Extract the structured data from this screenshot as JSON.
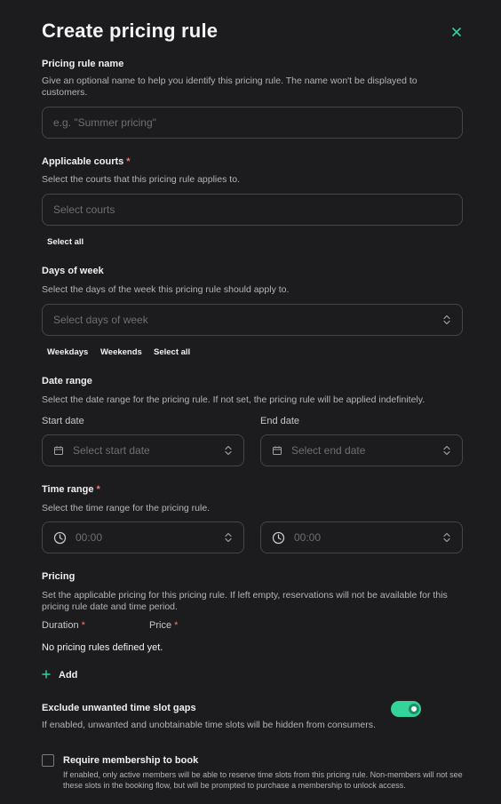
{
  "dialog": {
    "title": "Create pricing rule",
    "close_icon": "close-icon",
    "accent": "#34d399"
  },
  "name_field": {
    "label": "Pricing rule name",
    "help": "Give an optional name to help you identify this pricing rule. The name won't be displayed to customers.",
    "placeholder": "e.g. \"Summer pricing\""
  },
  "courts": {
    "label": "Applicable courts",
    "required": "*",
    "help": "Select the courts that this pricing rule applies to.",
    "placeholder": "Select courts",
    "select_all": "Select all"
  },
  "days": {
    "label": "Days of week",
    "help": "Select the days of the week this pricing rule should apply to.",
    "placeholder": "Select days of week",
    "shortcuts": [
      "Weekdays",
      "Weekends",
      "Select all"
    ]
  },
  "date_range": {
    "label": "Date range",
    "help": "Select the date range for the pricing rule. If not set, the pricing rule will be applied indefinitely.",
    "start_label": "Start date",
    "start_placeholder": "Select start date",
    "end_label": "End date",
    "end_placeholder": "Select end date"
  },
  "time_range": {
    "label": "Time range",
    "required": "*",
    "help": "Select the time range for the pricing rule.",
    "start_value": "00:00",
    "end_value": "00:00"
  },
  "pricing": {
    "label": "Pricing",
    "help": "Set the applicable pricing for this pricing rule. If left empty, reservations will not be available for this pricing rule date and time period.",
    "duration_label": "Duration",
    "price_label": "Price",
    "required": "*",
    "empty_text": "No pricing rules defined yet.",
    "add_label": "Add"
  },
  "exclude_gaps": {
    "label": "Exclude unwanted time slot gaps",
    "help": "If enabled, unwanted and unobtainable time slots will be hidden from consumers.",
    "enabled": true
  },
  "membership": {
    "label": "Require membership to book",
    "help": "If enabled, only active members will be able to reserve time slots from this pricing rule. Non-members will not see these slots in the booking flow, but will be prompted to purchase a membership to unlock access.",
    "checked": false
  }
}
